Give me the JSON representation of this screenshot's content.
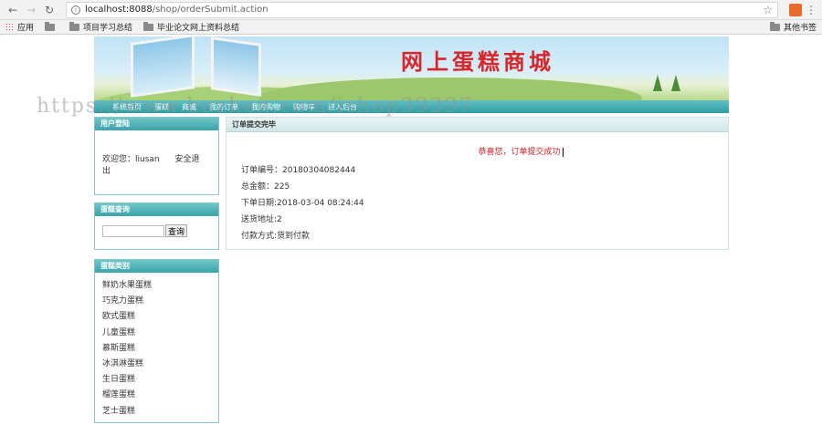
{
  "browser": {
    "url_host": "localhost:8088",
    "url_path": "/shop/orderSubmit.action",
    "bookmarks": [
      "应用",
      "",
      "项目学习总结",
      "毕业论文网上资料总结"
    ],
    "bookmarks_right": "其他书签"
  },
  "banner": {
    "title": "网上蛋糕商城"
  },
  "navbar": {
    "items": [
      "系统首页",
      "蛋糕",
      "商城",
      "我的订单",
      "我的购物",
      "购物车",
      "进入后台"
    ]
  },
  "watermark": "https://www.huzhan.com/ishop39397",
  "login": {
    "header": "用户登陆",
    "welcome": "欢迎您：liusan",
    "logout": "安全退出"
  },
  "search": {
    "header": "蛋糕查询",
    "input_value": "",
    "button": "查询"
  },
  "category": {
    "header": "蛋糕类别",
    "items": [
      "鲜奶水果蛋糕",
      "巧克力蛋糕",
      "欧式蛋糕",
      "儿童蛋糕",
      "慕斯蛋糕",
      "冰淇淋蛋糕",
      "生日蛋糕",
      "榴莲蛋糕",
      "芝士蛋糕"
    ]
  },
  "order": {
    "header": "订单提交完毕",
    "success": "恭喜您，订单提交成功",
    "order_no": "订单编号：20180304082444",
    "total": "总金额：225",
    "date": "下单日期:2018-03-04 08:24:44",
    "address": "送货地址:2",
    "payment": "付款方式:货到付款"
  }
}
